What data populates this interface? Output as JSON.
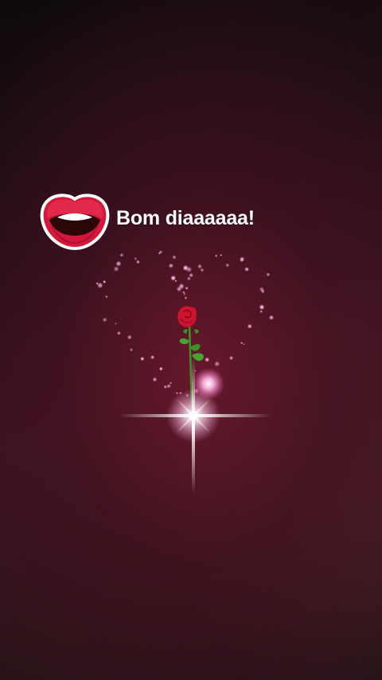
{
  "message": {
    "text": "Bom diaaaaaa!"
  },
  "icons": {
    "lips": "mouth-lips-icon",
    "rose": "red-rose",
    "sparkle": "four-point-star-sparkle"
  },
  "colors": {
    "lip_red": "#d4173a",
    "lip_outline": "#ffffff",
    "rose_red": "#c8102e",
    "stem_green": "#3f8f2a",
    "sparkle_pink": "#ff9ed9",
    "text": "#ffffff"
  }
}
